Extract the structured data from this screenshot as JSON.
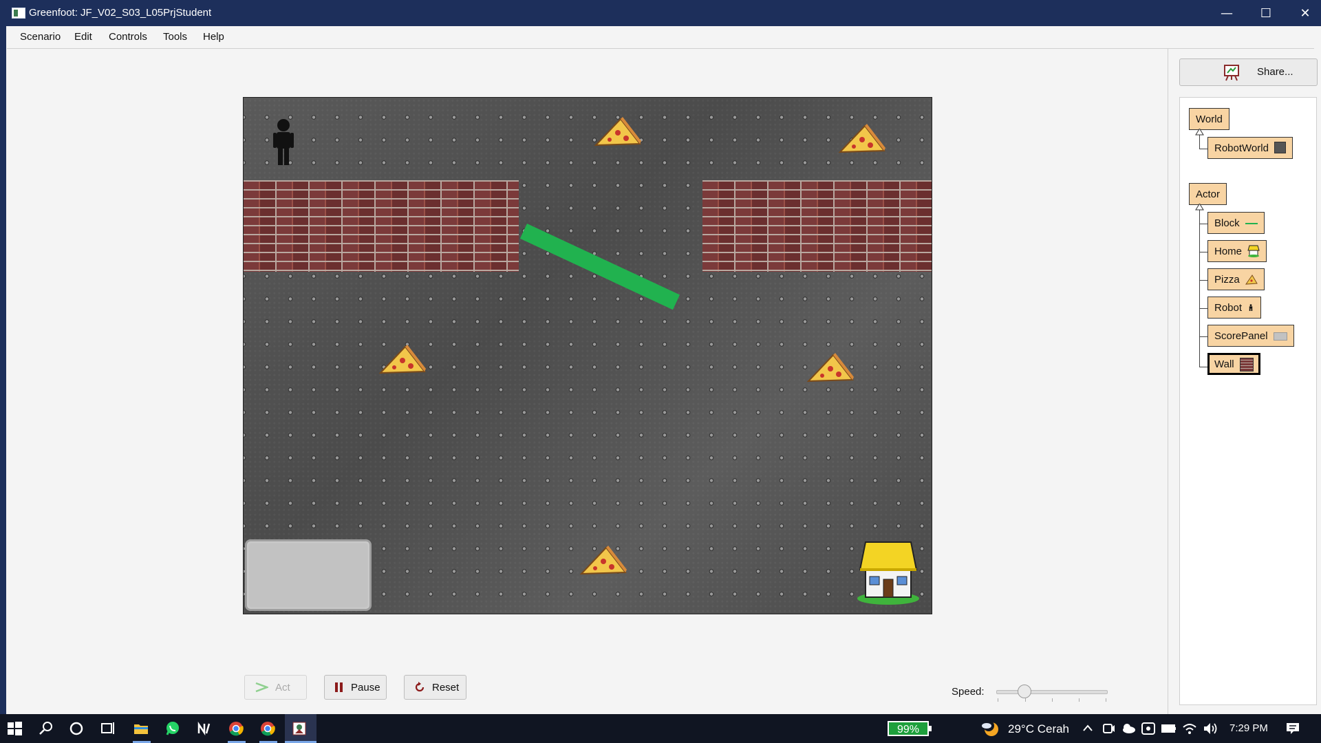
{
  "window": {
    "title": "Greenfoot: JF_V02_S03_L05PrjStudent",
    "minimize_glyph": "—",
    "maximize_glyph": "☐",
    "close_glyph": "✕"
  },
  "menu": {
    "items": [
      "Scenario",
      "Edit",
      "Controls",
      "Tools",
      "Help"
    ]
  },
  "world": {
    "actors": [
      "Robot",
      "Wall",
      "Wall",
      "Block",
      "Pizza",
      "Pizza",
      "Pizza",
      "Pizza",
      "Pizza",
      "ScorePanel",
      "Home"
    ],
    "colors": {
      "block": "#21b24f",
      "background": "#545454",
      "wall": "#7a3838"
    }
  },
  "share": {
    "label": "Share...",
    "icon": "easel-icon"
  },
  "class_tree": {
    "world_root": "World",
    "world_classes": [
      {
        "name": "RobotWorld",
        "icon": "world-thumb-icon"
      }
    ],
    "actor_root": "Actor",
    "actor_classes": [
      {
        "name": "Block",
        "icon": "block-line-icon"
      },
      {
        "name": "Home",
        "icon": "home-icon"
      },
      {
        "name": "Pizza",
        "icon": "pizza-icon"
      },
      {
        "name": "Robot",
        "icon": "robot-icon"
      },
      {
        "name": "ScorePanel",
        "icon": "scorepanel-icon"
      },
      {
        "name": "Wall",
        "icon": "wall-icon",
        "selected": true
      }
    ],
    "class_color": "#f8d4a3"
  },
  "controls": {
    "act_label": "Act",
    "pause_label": "Pause",
    "reset_label": "Reset",
    "speed_label": "Speed:",
    "speed_value": 0.25
  },
  "taskbar": {
    "battery": "99%",
    "weather": "29°C  Cerah",
    "time": "7:29 PM",
    "apps": [
      "file-explorer-icon",
      "whatsapp-icon",
      "notion-icon",
      "chrome-icon",
      "chrome-icon",
      "greenfoot-icon"
    ]
  }
}
